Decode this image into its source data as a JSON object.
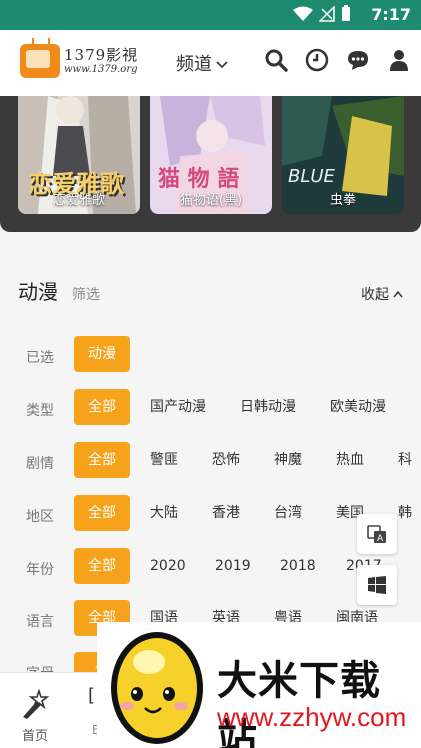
{
  "status": {
    "time": "7:17"
  },
  "header": {
    "logo_brand": "1379影視",
    "logo_url": "www.1379.org",
    "channel_label": "频道",
    "icons": [
      "search-icon",
      "history-icon",
      "message-icon",
      "user-icon"
    ]
  },
  "carousel": {
    "items": [
      {
        "label": "恋爱雅歌",
        "art_title": "恋爱雅歌"
      },
      {
        "label": "猫物语(黑)"
      },
      {
        "label": "虫拳"
      }
    ]
  },
  "panel": {
    "title": "动漫",
    "subtitle": "筛选",
    "collapse_label": "收起"
  },
  "filters": [
    {
      "label": "已选",
      "options": [
        "动漫"
      ]
    },
    {
      "label": "类型",
      "options": [
        "全部",
        "国产动漫",
        "日韩动漫",
        "欧美动漫"
      ]
    },
    {
      "label": "剧情",
      "options": [
        "全部",
        "警匪",
        "恐怖",
        "神魔",
        "热血",
        "科"
      ]
    },
    {
      "label": "地区",
      "options": [
        "全部",
        "大陆",
        "香港",
        "台湾",
        "美国",
        "韩"
      ]
    },
    {
      "label": "年份",
      "options": [
        "全部",
        "2020",
        "2019",
        "2018",
        "2017"
      ]
    },
    {
      "label": "语言",
      "options": [
        "全部",
        "国语",
        "英语",
        "粤语",
        "闽南语"
      ]
    },
    {
      "label": "字母",
      "options": [
        "全"
      ]
    }
  ],
  "bottom_nav": {
    "home_label": "首页",
    "second_label": "E"
  },
  "watermark": {
    "title": "大米下载站",
    "url": "www.zzhyw.com"
  },
  "colors": {
    "status_bar": "#1e8a6f",
    "accent": "#f7a21b",
    "watermark_url": "#e0171e"
  }
}
